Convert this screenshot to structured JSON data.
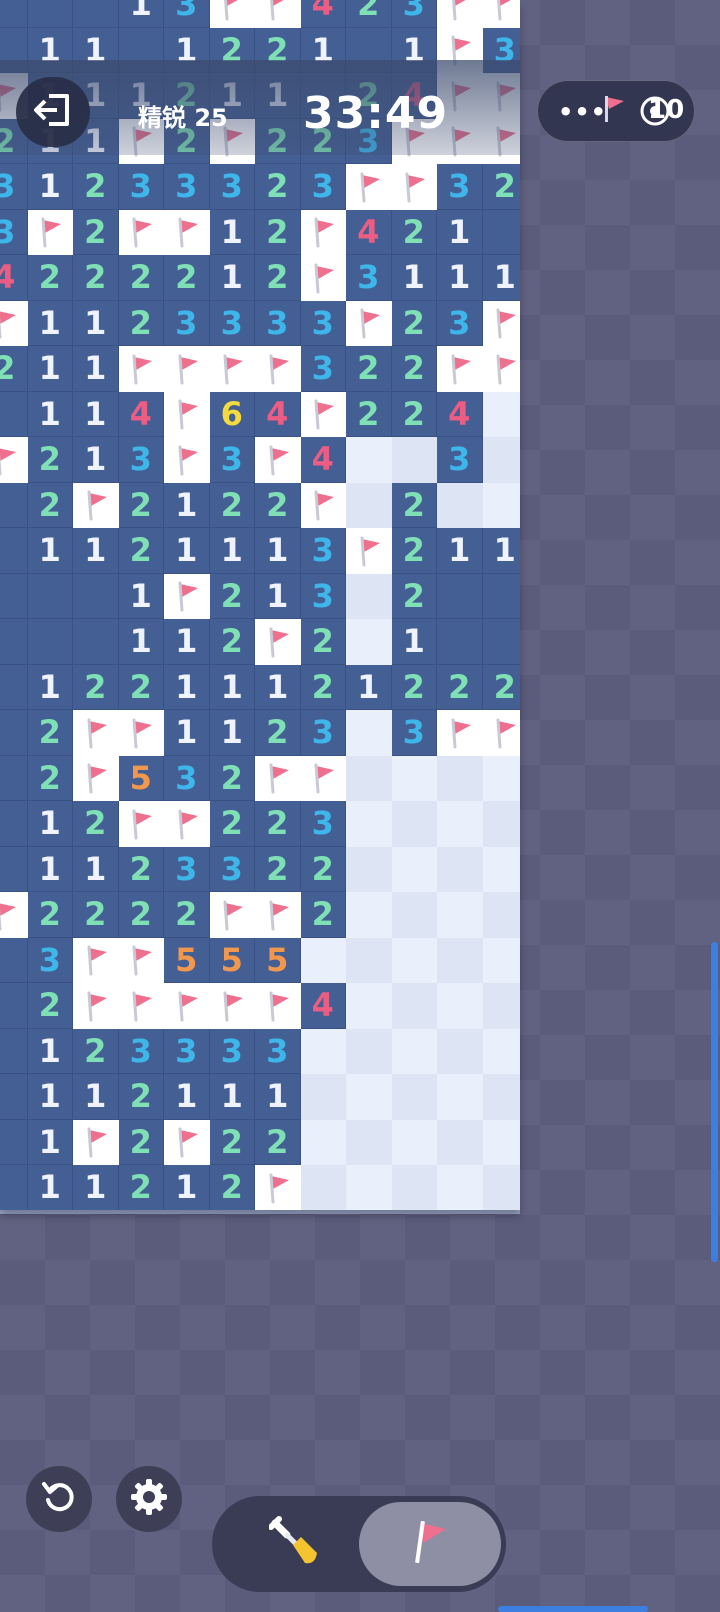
{
  "header": {
    "level": "精锐 25",
    "timer": "33:49",
    "flag_count": "10"
  },
  "capsule": {
    "dots": "•••"
  },
  "board": {
    "rows": [
      [
        "?",
        "?",
        "?",
        "1",
        "3",
        "F",
        "F",
        "4",
        "2",
        "3",
        "F",
        "F"
      ],
      [
        "?",
        "1",
        "1",
        "?",
        "1",
        "2",
        "2",
        "1",
        "?",
        "1",
        "F",
        "3"
      ],
      [
        "F",
        "1",
        "1",
        "1",
        "2",
        "1",
        "1",
        "?",
        "2",
        "4",
        "F",
        "F"
      ],
      [
        "2",
        "1",
        "1",
        "F",
        "2",
        "F",
        "2",
        "2",
        "3",
        "F",
        "F",
        "F"
      ],
      [
        "3",
        "1",
        "2",
        "3",
        "3",
        "3",
        "2",
        "3",
        "F",
        "F",
        "3",
        "2"
      ],
      [
        "3",
        "F",
        "2",
        "F",
        "F",
        "1",
        "2",
        "F",
        "4",
        "2",
        "1",
        "?"
      ],
      [
        "4",
        "2",
        "2",
        "2",
        "2",
        "1",
        "2",
        "F",
        "3",
        "1",
        "1",
        "1"
      ],
      [
        "F",
        "1",
        "1",
        "2",
        "3",
        "3",
        "3",
        "3",
        "F",
        "2",
        "3",
        "F"
      ],
      [
        "2",
        "1",
        "1",
        "F",
        "F",
        "F",
        "F",
        "3",
        "2",
        "2",
        "F",
        "F"
      ],
      [
        "?",
        "1",
        "1",
        "4",
        "F",
        "6",
        "4",
        "F",
        "2",
        "2",
        "4",
        "U"
      ],
      [
        "F",
        "2",
        "1",
        "3",
        "F",
        "3",
        "F",
        "4",
        "U",
        "U",
        "3",
        "U"
      ],
      [
        "?",
        "2",
        "F",
        "2",
        "1",
        "2",
        "2",
        "F",
        "U",
        "2",
        "U",
        "U"
      ],
      [
        "?",
        "1",
        "1",
        "2",
        "1",
        "1",
        "1",
        "3",
        "F",
        "2",
        "1",
        "1"
      ],
      [
        "?",
        "?",
        "?",
        "1",
        "F",
        "2",
        "1",
        "3",
        "U",
        "2",
        "?",
        "?"
      ],
      [
        "?",
        "?",
        "?",
        "1",
        "1",
        "2",
        "F",
        "2",
        "U",
        "1",
        "?",
        "?"
      ],
      [
        "?",
        "1",
        "2",
        "2",
        "1",
        "1",
        "1",
        "2",
        "1",
        "2",
        "2",
        "2"
      ],
      [
        "?",
        "2",
        "F",
        "F",
        "1",
        "1",
        "2",
        "3",
        "U",
        "3",
        "F",
        "F"
      ],
      [
        "?",
        "2",
        "F",
        "5",
        "3",
        "2",
        "F",
        "F",
        "U",
        "U",
        "U",
        "U"
      ],
      [
        "?",
        "1",
        "2",
        "F",
        "F",
        "2",
        "2",
        "3",
        "U",
        "U",
        "U",
        "U"
      ],
      [
        "?",
        "1",
        "1",
        "2",
        "3",
        "3",
        "2",
        "2",
        "U",
        "U",
        "U",
        "U"
      ],
      [
        "F",
        "2",
        "2",
        "2",
        "2",
        "F",
        "F",
        "2",
        "U",
        "U",
        "U",
        "U"
      ],
      [
        "?",
        "3",
        "F",
        "F",
        "5",
        "5",
        "5",
        "U",
        "U",
        "U",
        "U",
        "U"
      ],
      [
        "?",
        "2",
        "F",
        "F",
        "F",
        "F",
        "F",
        "4",
        "U",
        "U",
        "U",
        "U"
      ],
      [
        "?",
        "1",
        "2",
        "3",
        "3",
        "3",
        "3",
        "U",
        "U",
        "U",
        "U",
        "U"
      ],
      [
        "?",
        "1",
        "1",
        "2",
        "1",
        "1",
        "1",
        "U",
        "U",
        "U",
        "U",
        "U"
      ],
      [
        "?",
        "1",
        "F",
        "2",
        "F",
        "2",
        "2",
        "U",
        "U",
        "U",
        "U",
        "U"
      ],
      [
        "?",
        "1",
        "1",
        "2",
        "1",
        "2",
        "F",
        "U",
        "U",
        "U",
        "U",
        "U"
      ]
    ]
  },
  "controls": {
    "restart": "restart-icon",
    "settings": "gear-icon",
    "dig": "shovel-icon",
    "flag": "flag-icon",
    "active_mode": "flag"
  },
  "colors": {
    "board_revealed": "#445f93",
    "unknown_cell": "#eaf0fb",
    "flag": "#ee6f8e",
    "number_1": "#eef3ff",
    "number_2": "#7fe0b5",
    "number_3": "#3fb6ea",
    "number_4": "#ec5d83",
    "number_5": "#f2984e",
    "number_6": "#f4da3c"
  }
}
